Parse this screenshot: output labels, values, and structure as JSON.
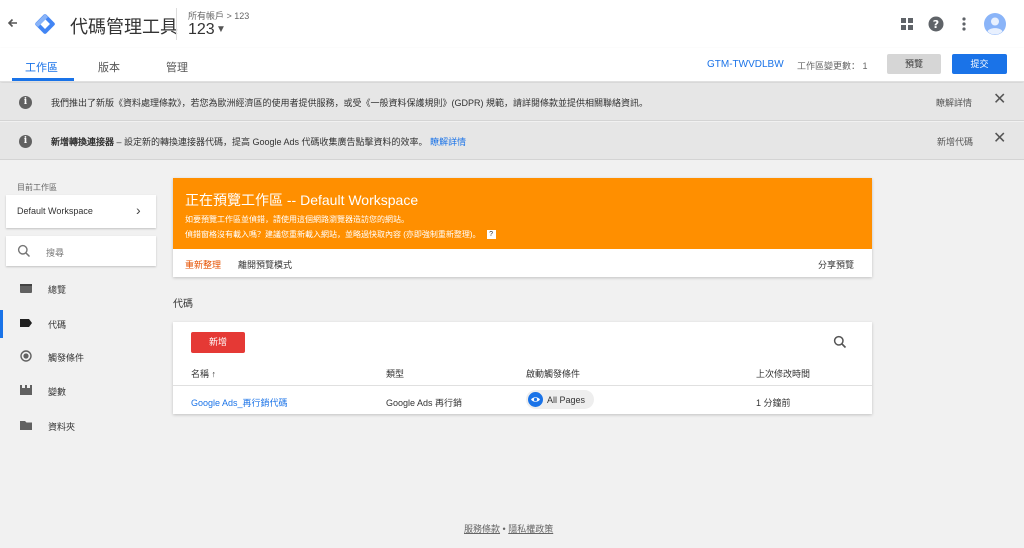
{
  "header": {
    "back_icon": "back-arrow-icon",
    "logo_icon": "gtm-diamond-logo",
    "app_title": "代碼管理工具",
    "breadcrumb": "所有帳戶 > 123",
    "container_name": "123",
    "icons": [
      "apps-grid-icon",
      "help-icon",
      "more-vert-icon",
      "account-avatar-icon"
    ]
  },
  "tabs": {
    "workspace": "工作區",
    "versions": "版本",
    "admin": "管理"
  },
  "toolbar": {
    "container_id": "GTM-TWVDLBW",
    "changes_label": "工作區變更數： 1",
    "preview_label": "預覽",
    "submit_label": "提交",
    "accent_color": "#1a73e8"
  },
  "notifications": [
    {
      "message": "我們推出了新版《資料處理條款》，若您為歐洲經濟區的使用者提供服務，或受《一般資料保護規則》(GDPR) 規範，請詳閱條款並提供相關聯絡資訊。",
      "action": "瞭解詳情"
    },
    {
      "message_bold": "新增轉換連接器",
      "message": " – 設定新的轉換連接器代碼，提高 Google Ads 代碼收集廣告點擊資料的效率。",
      "message_link": "瞭解詳情",
      "action": "新增代碼"
    }
  ],
  "sidebar": {
    "workspace_label": "目前工作區",
    "workspace_name": "Default Workspace",
    "search_placeholder": "搜尋",
    "items": [
      {
        "label": "總覽",
        "icon": "overview-icon"
      },
      {
        "label": "代碼",
        "icon": "tag-icon",
        "active": true
      },
      {
        "label": "觸發條件",
        "icon": "trigger-icon"
      },
      {
        "label": "變數",
        "icon": "variables-icon"
      },
      {
        "label": "資料夾",
        "icon": "folder-icon"
      }
    ]
  },
  "preview_banner": {
    "title": "正在預覽工作區 -- Default Workspace",
    "line1": "如要預覽工作區並偵錯，請使用這個網路瀏覽器造訪您的網站。",
    "line2": "偵錯窗格沒有載入嗎？建議您重新載入網站，並略過快取內容 (亦即強制重新整理)。",
    "refresh": "重新整理",
    "exit": "離開預覽模式",
    "share": "分享預覽",
    "color": "#ff8f00"
  },
  "tags": {
    "heading": "代碼",
    "new_button": "新增",
    "columns": [
      "名稱 ↑",
      "類型",
      "啟動觸發條件",
      "上次修改時間"
    ],
    "rows": [
      {
        "name": "Google Ads_再行銷代碼",
        "type": "Google Ads 再行銷",
        "trigger": "All Pages",
        "modified": "1 分鐘前"
      }
    ]
  },
  "footer": {
    "terms": "服務條款",
    "sep": "•",
    "privacy": "隱私權政策"
  }
}
